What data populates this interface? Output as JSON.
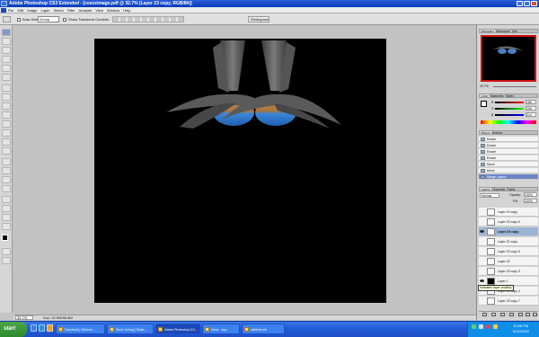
{
  "window": {
    "title": "Adobe Photoshop CS3 Extended - [ceeceimage.pdf @ 32.7% (Layer 23 copy, RGB/8#)]"
  },
  "menu": [
    "File",
    "Edit",
    "Image",
    "Layer",
    "Select",
    "Filter",
    "Analysis",
    "View",
    "Window",
    "Help"
  ],
  "options": {
    "auto_select_label": "Auto-Select:",
    "auto_select_value": "Group",
    "transform_controls_label": "Show Transform Controls",
    "workspace_label": "Workspace"
  },
  "status": {
    "zoom": "32.7%",
    "doc": "Doc: 22.9M/96.8M"
  },
  "navigator": {
    "tabs": [
      "Navigator",
      "Histogram",
      "Info"
    ],
    "zoom": "32.7%"
  },
  "color": {
    "tabs": [
      "Color",
      "Swatches",
      "Styles"
    ],
    "values": [
      "186",
      "199",
      "214"
    ],
    "channel_labels": [
      "R",
      "G",
      "B"
    ]
  },
  "history": {
    "tabs": [
      "History",
      "Actions"
    ],
    "items": [
      "Eraser",
      "Eraser",
      "Eraser",
      "Eraser",
      "Move",
      "Move",
      "Merge Layers"
    ]
  },
  "layers": {
    "tabs": [
      "Layers",
      "Channels",
      "Paths"
    ],
    "blend_mode": "Normal",
    "opacity_label": "Opacity:",
    "opacity": "100%",
    "fill_label": "Fill:",
    "fill": "100%",
    "items": [
      {
        "name": "Layer 19 copy",
        "visible": false
      },
      {
        "name": "Layer 23 copy 6",
        "visible": false
      },
      {
        "name": "Layer 23 copy",
        "visible": true
      },
      {
        "name": "Layer 22 copy",
        "visible": false
      },
      {
        "name": "Layer 23 copy 5",
        "visible": false
      },
      {
        "name": "Layer 22",
        "visible": false
      },
      {
        "name": "Layer 23 copy 3",
        "visible": false
      },
      {
        "name": "Layer 1",
        "visible": true
      },
      {
        "name": "Layer 23 copy 4",
        "visible": false
      },
      {
        "name": "Layer 23 copy 7",
        "visible": false
      }
    ],
    "tooltip": "Indicates layer visibility"
  },
  "taskbar": {
    "start": "start",
    "items": [
      "Facebook | Window...",
      "Stock Xchng | Stoke...",
      "Adobe Photoshop CS...",
      "Inbox - sup...",
      "slaidertruck"
    ],
    "time": "10:56 PM",
    "date": "9/22/2010"
  },
  "colors": {
    "title_bar": "#0a3cb8",
    "canvas": "#000000",
    "taskbar": "#245edb",
    "start_button": "#2b8a2b",
    "selected_layer": "#9db4d6"
  }
}
